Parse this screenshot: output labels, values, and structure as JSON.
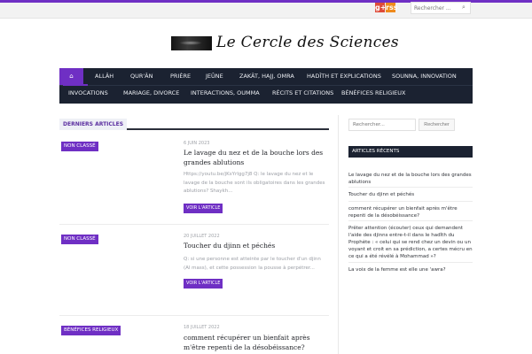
{
  "topbar": {
    "social": {
      "gplus": "g+",
      "rss": "rss"
    },
    "search_placeholder": "Rechercher ..."
  },
  "logo": {
    "text": "Le Cercle des Sciences"
  },
  "nav": {
    "home_icon": "home-icon",
    "row1": [
      "ALLÂH",
      "QUR'ÂN",
      "PRIÈRE",
      "JEÛNE",
      "ZAKÂT, HAJJ, OMRA",
      "HADÎTH ET EXPLICATIONS",
      "SOUNNA, INNOVATION"
    ],
    "row2": [
      "INVOCATIONS",
      "MARIAGE, DIVORCE",
      "INTERACTIONS, OUMMA",
      "RÉCITS ET CITATIONS",
      "BÉNÉFICES RELIGIEUX"
    ]
  },
  "main": {
    "section_title": "DERNIERS ARTICLES",
    "posts": [
      {
        "category": "NON CLASSÉ",
        "date": "6 JUIN 2023",
        "title": "Le lavage du nez et de la bouche lors des grandes ablutions",
        "excerpt": "Https://youtu.be/jKsYrIgg7j8 Q: le lavage du nez et le lavage de la bouche sont ils obligatoires dans les grandes ablutions? Shaykh...",
        "more": "VOIR L'ARTICLE"
      },
      {
        "category": "NON CLASSÉ",
        "date": "20 JUILLET 2022",
        "title": "Toucher du djinn et péchés",
        "excerpt": "Q: si une personne est atteinte par le toucher d'un djinn (Al mass), et cette possession la pousse à perpétrer...",
        "more": "VOIR L'ARTICLE"
      },
      {
        "category": "BÉNÉFICES RELIGIEUX",
        "date": "18 JUILLET 2022",
        "title": "comment récupérer un bienfait après m'être repenti de la désobéissance?"
      }
    ]
  },
  "sidebar": {
    "search_placeholder": "Rechercher...",
    "search_button": "Rechercher",
    "recent_title": "ARTICLES RÉCENTS",
    "recent": [
      "Le lavage du nez et de la bouche lors des grandes ablutions",
      "Toucher du djinn et péchés",
      "comment récupérer un bienfait après m'être repenti de la désobéissance?",
      "Prêter attention (écouter) ceux qui demandent l'aide des djinns entre-t-il dans le hadîth du Prophète : « celui qui se rend chez un devin ou un voyant et croit en sa prédiction, a certes mécru en ce qui a été révélé à Mohammad »?",
      "La voix de la femme est elle une 'awra?"
    ]
  },
  "colors": {
    "accent": "#6f2fc4",
    "nav_bg": "#1b2231"
  }
}
